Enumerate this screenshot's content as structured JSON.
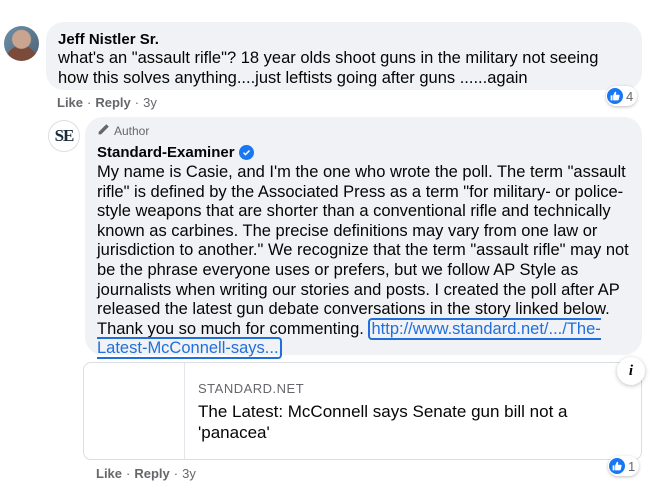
{
  "comment1": {
    "author": "Jeff Nistler Sr.",
    "text": "what's an \"assault rifle\"? 18 year olds shoot guns in the military not seeing how this solves anything....just leftists going after guns ......again",
    "actions": {
      "like": "Like",
      "reply": "Reply",
      "time": "3y"
    },
    "reaction_count": "4"
  },
  "reply": {
    "badge": "Author",
    "avatar_text": "SE",
    "author": "Standard-Examiner",
    "text": "My name is Casie, and I'm the one who wrote the poll. The term \"assault rifle\" is defined by the Associated Press as a term \"for military- or police-style weapons that are shorter than a conventional rifle and technically known as carbines. The precise definitions may vary from one law or jurisdiction to another.\" We recognize that the term \"assault rifle\" may not be the phrase everyone uses or prefers, but we follow AP Style as journalists when writing our stories and posts. I created the poll after AP released the latest gun debate conversations in the story linked below. Thank you so much for commenting.",
    "link_text": "http://www.standard.net/.../The-Latest-McConnell-says...",
    "preview": {
      "domain": "STANDARD.NET",
      "title": "The Latest: McConnell says Senate gun bill not a 'panacea'",
      "info_glyph": "i"
    },
    "actions": {
      "like": "Like",
      "reply": "Reply",
      "time": "3y"
    },
    "reaction_count": "1"
  },
  "colors": {
    "accent": "#1877f2",
    "bubble": "#f0f2f5",
    "link": "#216fdb",
    "meta": "#65676b"
  }
}
